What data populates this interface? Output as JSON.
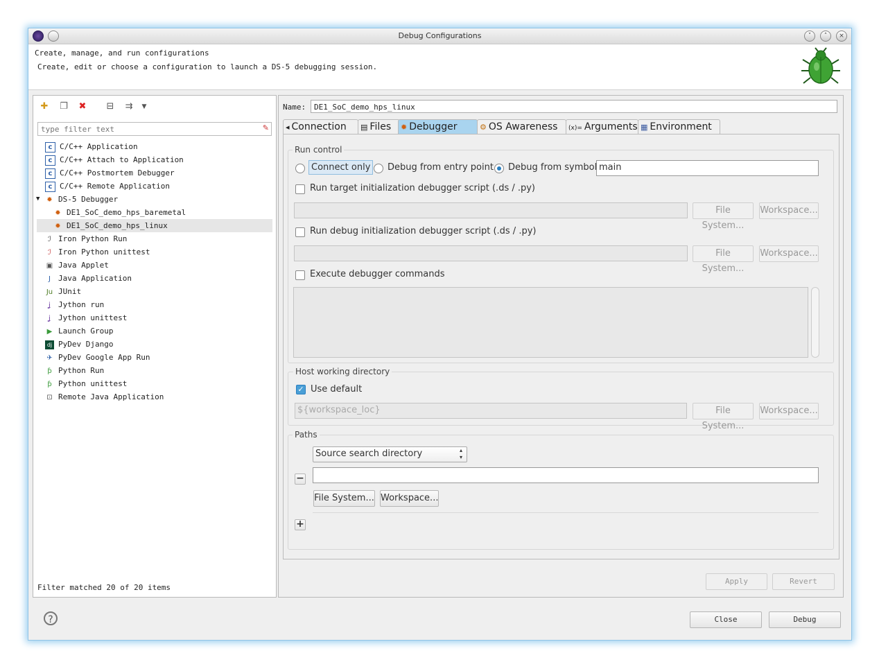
{
  "window": {
    "title": "Debug Configurations"
  },
  "header": {
    "line1": "Create, manage, and run configurations",
    "line2": "Create, edit or choose a configuration to launch a DS-5 debugging session."
  },
  "left": {
    "filter_placeholder": "type filter text",
    "tree": [
      {
        "label": "C/C++ Application",
        "icon": "c-app-icon",
        "glyph": "c"
      },
      {
        "label": "C/C++ Attach to Application",
        "icon": "c-attach-icon",
        "glyph": "c"
      },
      {
        "label": "C/C++ Postmortem Debugger",
        "icon": "c-postmortem-icon",
        "glyph": "c"
      },
      {
        "label": "C/C++ Remote Application",
        "icon": "c-remote-icon",
        "glyph": "c"
      },
      {
        "label": "DS-5 Debugger",
        "icon": "ds5-debugger-icon",
        "glyph": "✹"
      },
      {
        "label": "DE1_SoC_demo_hps_baremetal",
        "icon": "ds5-config-icon",
        "glyph": "✹"
      },
      {
        "label": "DE1_SoC_demo_hps_linux",
        "icon": "ds5-config-icon",
        "glyph": "✹"
      },
      {
        "label": "Iron Python Run",
        "icon": "iron-python-icon",
        "glyph": "ℐ"
      },
      {
        "label": "Iron Python unittest",
        "icon": "iron-python-unittest-icon",
        "glyph": "ℐ"
      },
      {
        "label": "Java Applet",
        "icon": "java-applet-icon",
        "glyph": "▣"
      },
      {
        "label": "Java Application",
        "icon": "java-application-icon",
        "glyph": "J"
      },
      {
        "label": "JUnit",
        "icon": "junit-icon",
        "glyph": "Ju"
      },
      {
        "label": "Jython run",
        "icon": "jython-icon",
        "glyph": "ʝ"
      },
      {
        "label": "Jython unittest",
        "icon": "jython-unittest-icon",
        "glyph": "ʝ"
      },
      {
        "label": "Launch Group",
        "icon": "launch-group-icon",
        "glyph": "▶"
      },
      {
        "label": "PyDev Django",
        "icon": "django-icon",
        "glyph": "dj"
      },
      {
        "label": "PyDev Google App Run",
        "icon": "google-app-icon",
        "glyph": "✈"
      },
      {
        "label": "Python Run",
        "icon": "python-icon",
        "glyph": "ƥ"
      },
      {
        "label": "Python unittest",
        "icon": "python-unittest-icon",
        "glyph": "ƥ"
      },
      {
        "label": "Remote Java Application",
        "icon": "remote-java-icon",
        "glyph": "⊡"
      }
    ],
    "status": "Filter matched 20 of 20 items"
  },
  "right": {
    "name_label": "Name:",
    "name_value": "DE1_SoC_demo_hps_linux",
    "tabs": [
      {
        "label": "Connection",
        "icon": "connection-icon",
        "glyph": "◂"
      },
      {
        "label": "Files",
        "icon": "files-icon",
        "glyph": "▤"
      },
      {
        "label": "Debugger",
        "icon": "debugger-icon",
        "glyph": "✹"
      },
      {
        "label": "OS Awareness",
        "icon": "os-awareness-icon",
        "glyph": "⚙"
      },
      {
        "label": "Arguments",
        "icon": "arguments-icon",
        "glyph": "(x)="
      },
      {
        "label": "Environment",
        "icon": "environment-icon",
        "glyph": "▦"
      }
    ],
    "run_control": {
      "title": "Run control",
      "opt_connect": "Connect only",
      "opt_entry": "Debug from entry point",
      "opt_symbol": "Debug from symbol",
      "symbol_value": "main",
      "target_script_label": "Run target initialization debugger script (.ds / .py)",
      "debug_script_label": "Run debug initialization debugger script (.ds / .py)",
      "exec_commands_label": "Execute debugger commands",
      "file_system": "File System...",
      "workspace": "Workspace..."
    },
    "host_dir": {
      "title": "Host working directory",
      "use_default": "Use default",
      "path_value": "${workspace_loc}",
      "file_system": "File System...",
      "workspace": "Workspace..."
    },
    "paths": {
      "title": "Paths",
      "select_value": "Source search directory",
      "minus": "−",
      "plus": "+",
      "file_system": "File System...",
      "workspace": "Workspace..."
    },
    "apply": "Apply",
    "revert": "Revert"
  },
  "bottom": {
    "close": "Close",
    "debug": "Debug",
    "help": "?"
  }
}
